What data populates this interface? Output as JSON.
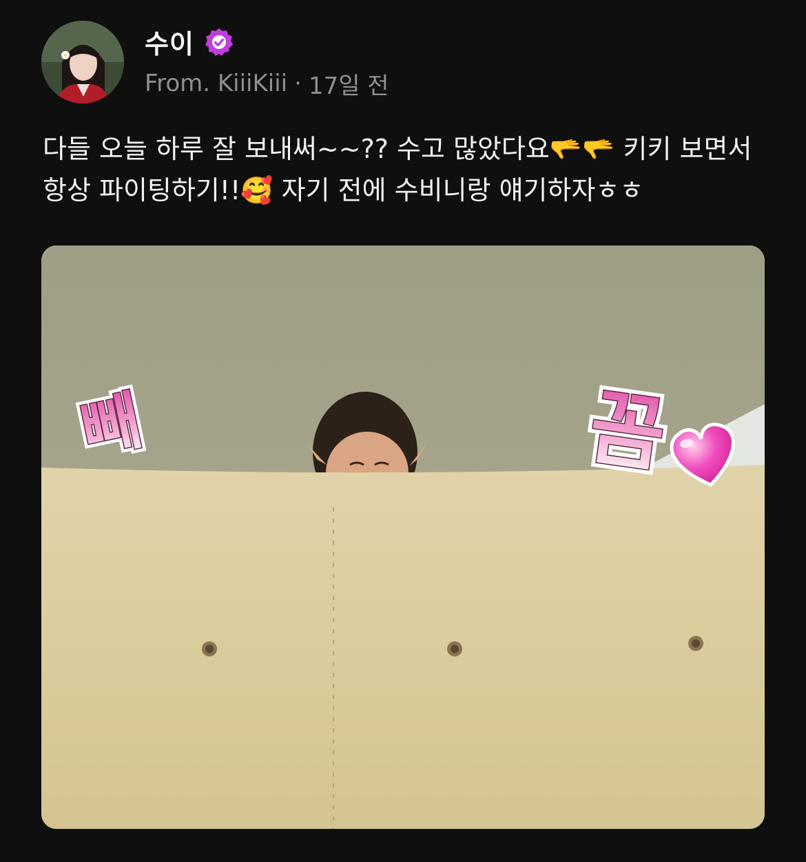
{
  "author": {
    "name": "수이",
    "verified": true,
    "source_prefix": "From.",
    "source_name": "KiiiKiii",
    "separator": "·",
    "time_ago": "17일 전"
  },
  "post": {
    "text": "다들 오늘 하루 잘 보내써~~?? 수고 많았다요🫳🫳 키키 보면서 항상 파이팅하기!!🥰 자기 전에 수비니랑 얘기하자ㅎㅎ"
  },
  "media": {
    "sticker_left": "빼",
    "sticker_right": "꼼"
  },
  "colors": {
    "background": "#0f0f10",
    "verified_badge": "#c13de0",
    "secondary_text": "#8f8f94",
    "sticker_pink": "#e04fa8"
  }
}
